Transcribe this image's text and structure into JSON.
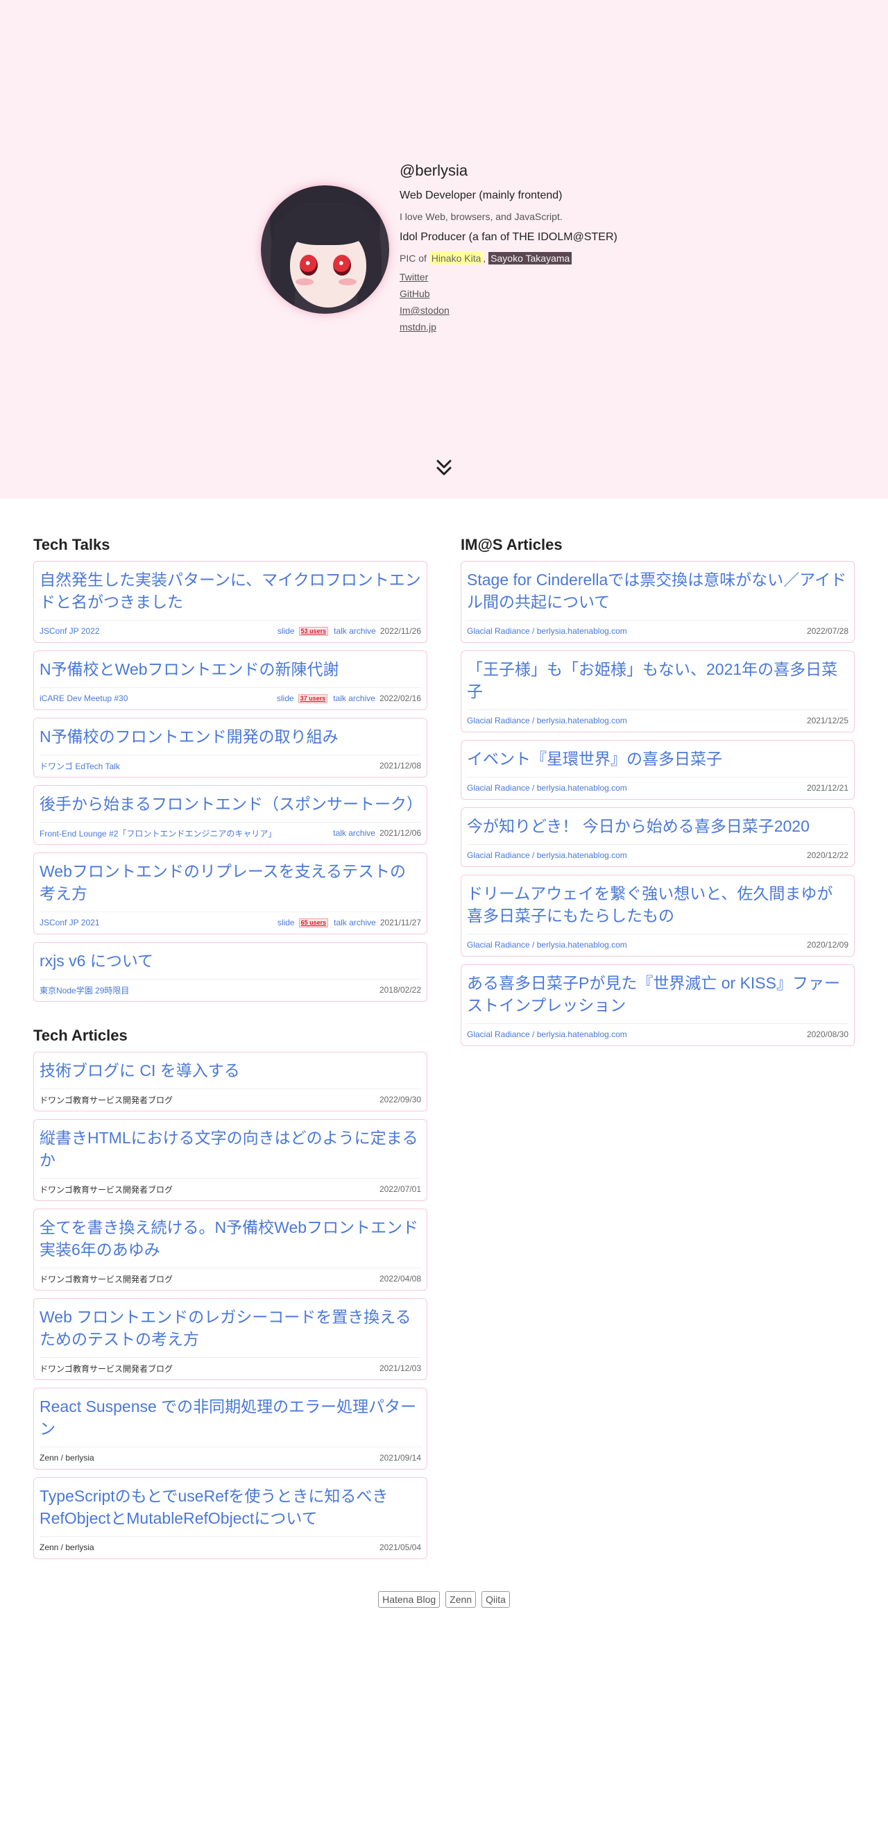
{
  "profile": {
    "handle": "@berlysia",
    "role": "Web Developer (mainly frontend)",
    "description": "I love Web, browsers, and JavaScript.",
    "producer": "Idol Producer (a fan of THE IDOLM@STER)",
    "pic_prefix": "PIC of",
    "pic_name1": "Hinako Kita",
    "pic_sep": ",",
    "pic_name2": "Sayoko Takayama",
    "links": [
      "Twitter",
      "GitHub",
      "Im@stodon",
      "mstdn.jp"
    ]
  },
  "sections": {
    "tech_talks": "Tech Talks",
    "imas_articles": "IM@S Articles",
    "tech_articles": "Tech Articles"
  },
  "tech_talks": [
    {
      "title": "自然発生した実装パターンに、マイクロフロントエンドと名がつきました",
      "source": "JSConf JP 2022",
      "slide": "slide",
      "users": "53 users",
      "archive": "talk archive",
      "date": "2022/11/26"
    },
    {
      "title": "N予備校とWebフロントエンドの新陳代謝",
      "source": "iCARE Dev Meetup #30",
      "slide": "slide",
      "users": "37 users",
      "archive": "talk archive",
      "date": "2022/02/16"
    },
    {
      "title": "N予備校のフロントエンド開発の取り組み",
      "source": "ドワンゴ EdTech Talk",
      "date": "2021/12/08"
    },
    {
      "title": "後手から始まるフロントエンド（スポンサートーク）",
      "source": "Front-End Lounge #2「フロントエンドエンジニアのキャリア」",
      "archive": "talk archive",
      "date": "2021/12/06"
    },
    {
      "title": "Webフロントエンドのリプレースを支えるテストの考え方",
      "source": "JSConf JP 2021",
      "slide": "slide",
      "users": "65 users",
      "archive": "talk archive",
      "date": "2021/11/27"
    },
    {
      "title": "rxjs v6 について",
      "source": "東京Node学園 29時限目",
      "date": "2018/02/22"
    }
  ],
  "imas_articles": [
    {
      "title": "Stage for Cinderellaでは票交換は意味がない／アイドル間の共起について",
      "source": "Glacial Radiance / berlysia.hatenablog.com",
      "date": "2022/07/28"
    },
    {
      "title": "「王子様」も「お姫様」もない、2021年の喜多日菜子",
      "source": "Glacial Radiance / berlysia.hatenablog.com",
      "date": "2021/12/25"
    },
    {
      "title": "イベント『星環世界』の喜多日菜子",
      "source": "Glacial Radiance / berlysia.hatenablog.com",
      "date": "2021/12/21"
    },
    {
      "title": "今が知りどき！ 今日から始める喜多日菜子2020",
      "source": "Glacial Radiance / berlysia.hatenablog.com",
      "date": "2020/12/22"
    },
    {
      "title": "ドリームアウェイを繋ぐ強い想いと、佐久間まゆが喜多日菜子にもたらしたもの",
      "source": "Glacial Radiance / berlysia.hatenablog.com",
      "date": "2020/12/09"
    },
    {
      "title": "ある喜多日菜子Pが見た『世界滅亡 or KISS』ファーストインプレッション",
      "source": "Glacial Radiance / berlysia.hatenablog.com",
      "date": "2020/08/30"
    }
  ],
  "tech_articles": [
    {
      "title": "技術ブログに CI を導入する",
      "source": "ドワンゴ教育サービス開発者ブログ",
      "date": "2022/09/30"
    },
    {
      "title": "縦書きHTMLにおける文字の向きはどのように定まるか",
      "source": "ドワンゴ教育サービス開発者ブログ",
      "date": "2022/07/01"
    },
    {
      "title": "全てを書き換え続ける。N予備校Webフロントエンド実装6年のあゆみ",
      "source": "ドワンゴ教育サービス開発者ブログ",
      "date": "2022/04/08"
    },
    {
      "title": "Web フロントエンドのレガシーコードを置き換えるためのテストの考え方",
      "source": "ドワンゴ教育サービス開発者ブログ",
      "date": "2021/12/03"
    },
    {
      "title": "React Suspense での非同期処理のエラー処理パターン",
      "source": "Zenn / berlysia",
      "date": "2021/09/14"
    },
    {
      "title": "TypeScriptのもとでuseRefを使うときに知るべきRefObjectとMutableRefObjectについて",
      "source": "Zenn / berlysia",
      "date": "2021/05/04"
    }
  ],
  "footer": [
    "Hatena Blog",
    "Zenn",
    "Qiita"
  ],
  "colors": {
    "hero_bg": "#fdeff4",
    "link": "#4a78d8",
    "card_border": "#f6c9d8",
    "badge": "#d81b2a"
  }
}
